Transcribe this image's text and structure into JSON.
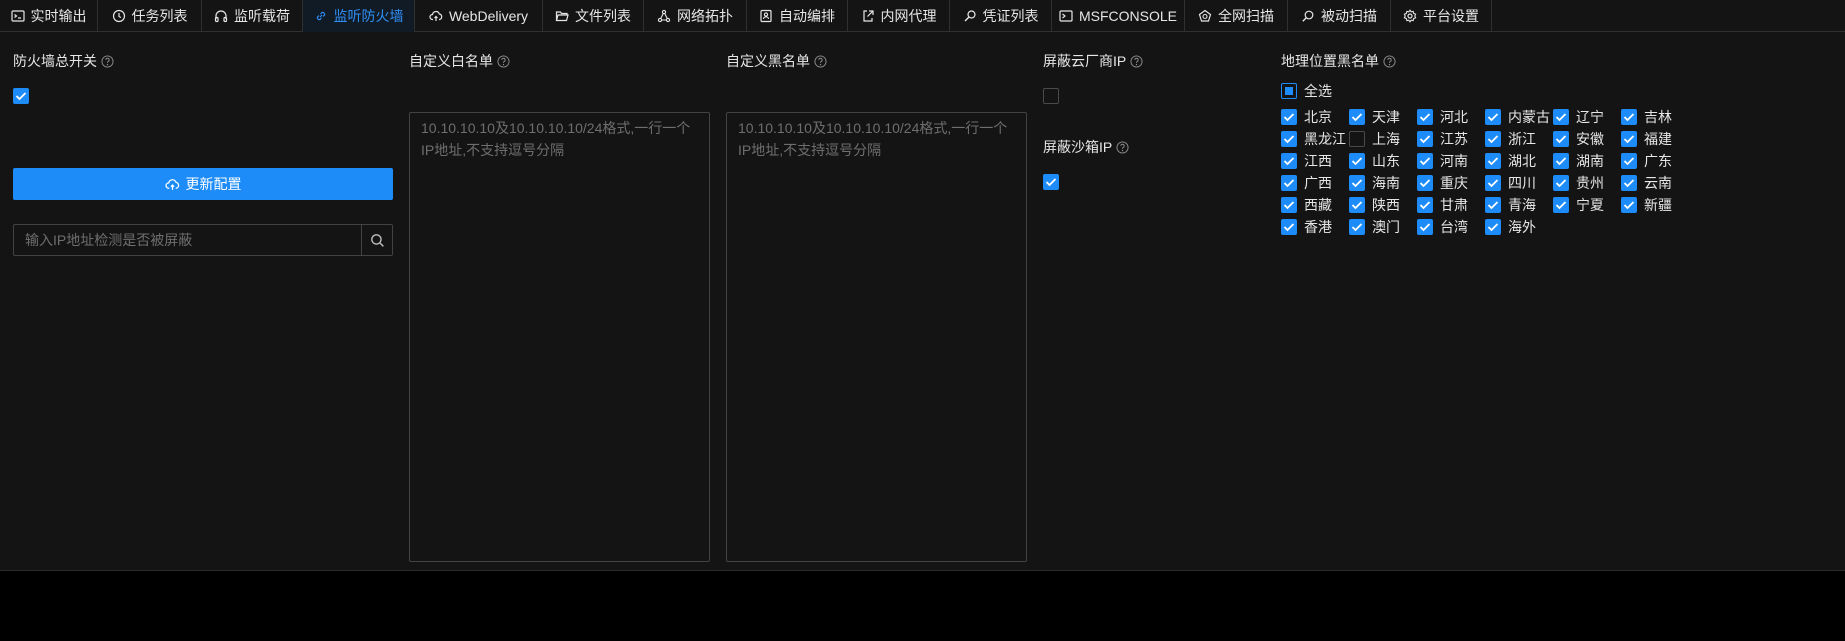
{
  "tabs": [
    {
      "label": "实时输出",
      "icon": "terminal-icon",
      "active": false
    },
    {
      "label": "任务列表",
      "icon": "clock-icon",
      "active": false
    },
    {
      "label": "监听载荷",
      "icon": "headphones-icon",
      "active": false
    },
    {
      "label": "监听防火墙",
      "icon": "link-icon",
      "active": true
    },
    {
      "label": "WebDelivery",
      "icon": "cloud-icon",
      "active": false
    },
    {
      "label": "文件列表",
      "icon": "folder-icon",
      "active": false
    },
    {
      "label": "网络拓扑",
      "icon": "network-icon",
      "active": false
    },
    {
      "label": "自动编排",
      "icon": "contacts-book-icon",
      "active": false
    },
    {
      "label": "内网代理",
      "icon": "proxy-icon",
      "active": false
    },
    {
      "label": "凭证列表",
      "icon": "key-search-icon",
      "active": false
    },
    {
      "label": "MSFCONSOLE",
      "icon": "console-icon",
      "active": false
    },
    {
      "label": "全网扫描",
      "icon": "radar-icon",
      "active": false
    },
    {
      "label": "被动扫描",
      "icon": "search-icon",
      "active": false
    },
    {
      "label": "平台设置",
      "icon": "gear-icon",
      "active": false
    }
  ],
  "firewall": {
    "switch_label": "防火墙总开关",
    "enabled": true,
    "update_button": "更新配置",
    "check_placeholder": "输入IP地址检测是否被屏蔽",
    "check_value": ""
  },
  "whitelist": {
    "label": "自定义白名单",
    "placeholder": "10.10.10.10及10.10.10.10/24格式,一行一个IP地址,不支持逗号分隔",
    "value": ""
  },
  "blacklist": {
    "label": "自定义黑名单",
    "placeholder": "10.10.10.10及10.10.10.10/24格式,一行一个IP地址,不支持逗号分隔",
    "value": ""
  },
  "cloud": {
    "label": "屏蔽云厂商IP",
    "checked": false
  },
  "sandbox": {
    "label": "屏蔽沙箱IP",
    "checked": true
  },
  "geo": {
    "label": "地理位置黑名单",
    "select_all": "全选",
    "select_all_state": "partial",
    "provinces": [
      {
        "name": "北京",
        "checked": true
      },
      {
        "name": "天津",
        "checked": true
      },
      {
        "name": "河北",
        "checked": true
      },
      {
        "name": "内蒙古",
        "checked": true
      },
      {
        "name": "辽宁",
        "checked": true
      },
      {
        "name": "吉林",
        "checked": true
      },
      {
        "name": "黑龙江",
        "checked": true
      },
      {
        "name": "上海",
        "checked": false
      },
      {
        "name": "江苏",
        "checked": true
      },
      {
        "name": "浙江",
        "checked": true
      },
      {
        "name": "安徽",
        "checked": true
      },
      {
        "name": "福建",
        "checked": true
      },
      {
        "name": "江西",
        "checked": true
      },
      {
        "name": "山东",
        "checked": true
      },
      {
        "name": "河南",
        "checked": true
      },
      {
        "name": "湖北",
        "checked": true
      },
      {
        "name": "湖南",
        "checked": true
      },
      {
        "name": "广东",
        "checked": true
      },
      {
        "name": "广西",
        "checked": true
      },
      {
        "name": "海南",
        "checked": true
      },
      {
        "name": "重庆",
        "checked": true
      },
      {
        "name": "四川",
        "checked": true
      },
      {
        "name": "贵州",
        "checked": true
      },
      {
        "name": "云南",
        "checked": true
      },
      {
        "name": "西藏",
        "checked": true
      },
      {
        "name": "陕西",
        "checked": true
      },
      {
        "name": "甘肃",
        "checked": true
      },
      {
        "name": "青海",
        "checked": true
      },
      {
        "name": "宁夏",
        "checked": true
      },
      {
        "name": "新疆",
        "checked": true
      },
      {
        "name": "香港",
        "checked": true
      },
      {
        "name": "澳门",
        "checked": true
      },
      {
        "name": "台湾",
        "checked": true
      },
      {
        "name": "海外",
        "checked": true
      }
    ]
  },
  "colors": {
    "accent": "#1d8cf8",
    "background": "#141414",
    "border": "#434343"
  }
}
